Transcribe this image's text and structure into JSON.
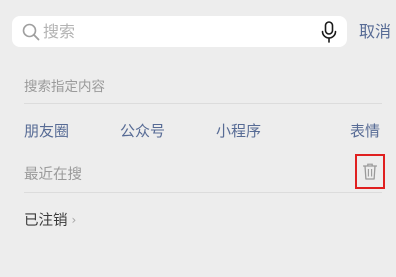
{
  "search": {
    "placeholder": "搜索",
    "value": "",
    "cancel_label": "取消"
  },
  "section": {
    "title": "搜索指定内容",
    "categories": [
      {
        "label": "朋友圈"
      },
      {
        "label": "公众号"
      },
      {
        "label": "小程序"
      },
      {
        "label": "表情"
      }
    ]
  },
  "recent": {
    "title": "最近在搜",
    "items": [
      {
        "label": "已注销",
        "chevron": "›"
      }
    ]
  },
  "colors": {
    "link": "#576b95",
    "highlight_box": "#e02020",
    "background": "#ededed"
  },
  "icons": {
    "search": "search-icon",
    "mic": "microphone-icon",
    "trash": "trash-icon",
    "chevron": "chevron-right-icon"
  }
}
